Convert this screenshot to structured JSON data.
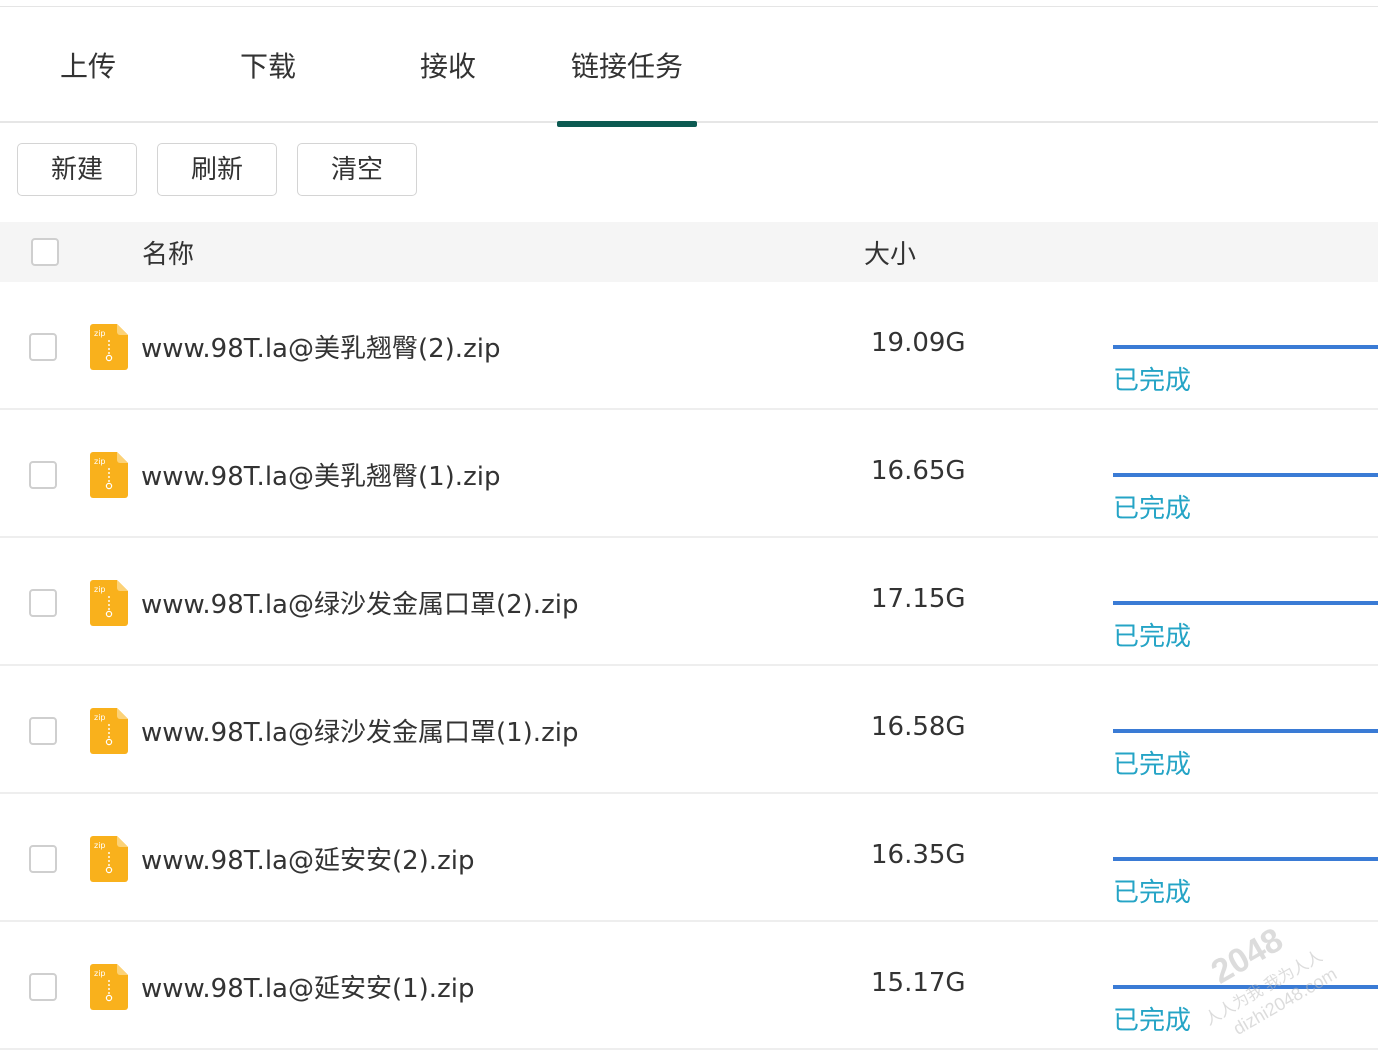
{
  "tabs": [
    {
      "label": "上传"
    },
    {
      "label": "下载"
    },
    {
      "label": "接收"
    },
    {
      "label": "链接任务"
    }
  ],
  "active_tab": 3,
  "toolbar": {
    "new_label": "新建",
    "refresh_label": "刷新",
    "clear_label": "清空"
  },
  "table": {
    "col_name": "名称",
    "col_size": "大小",
    "rows": [
      {
        "name": "www.98T.la@美乳翘臀(2).zip",
        "size": "19.09G",
        "status": "已完成",
        "progress": 100
      },
      {
        "name": "www.98T.la@美乳翘臀(1).zip",
        "size": "16.65G",
        "status": "已完成",
        "progress": 100
      },
      {
        "name": "www.98T.la@绿沙发金属口罩(2).zip",
        "size": "17.15G",
        "status": "已完成",
        "progress": 100
      },
      {
        "name": "www.98T.la@绿沙发金属口罩(1).zip",
        "size": "16.58G",
        "status": "已完成",
        "progress": 100
      },
      {
        "name": "www.98T.la@延安安(2).zip",
        "size": "16.35G",
        "status": "已完成",
        "progress": 100
      },
      {
        "name": "www.98T.la@延安安(1).zip",
        "size": "15.17G",
        "status": "已完成",
        "progress": 100
      }
    ]
  },
  "file_icon": {
    "name": "zip-file-icon",
    "label": "zip",
    "color": "#f9b11c"
  },
  "colors": {
    "tab_underline": "#0c5a52",
    "progress": "#3a7bd5",
    "status": "#25a4c6"
  },
  "watermark": {
    "line1": "2048",
    "line2": "人人为我 我为人人",
    "line3": "dizhi2048.com"
  }
}
